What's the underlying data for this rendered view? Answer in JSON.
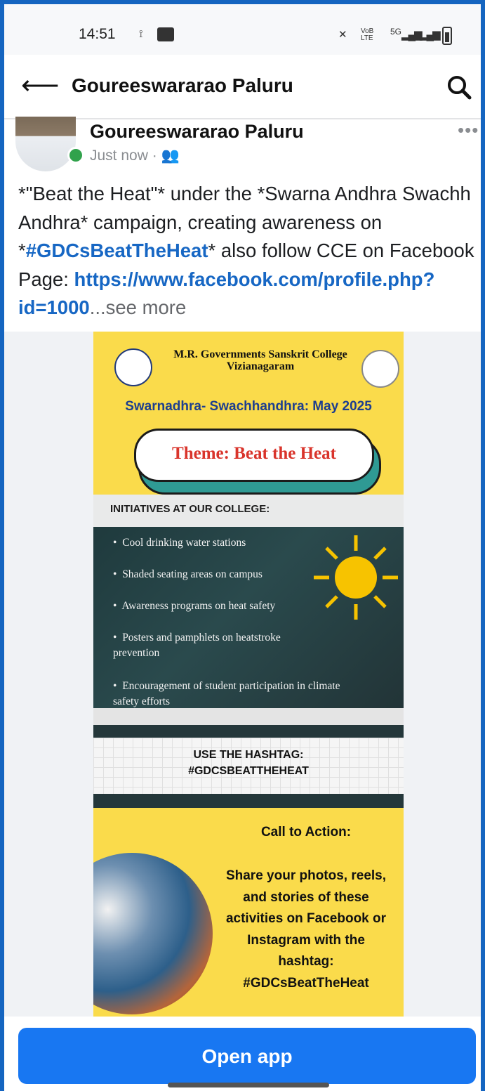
{
  "status_bar": {
    "time": "14:51",
    "net_label": "Vo))\nLTE1",
    "signal_label": "5G"
  },
  "top_bar": {
    "title": "Goureeswararao Paluru"
  },
  "post": {
    "author": "Goureeswararao Paluru",
    "time": "Just now",
    "separator": "·",
    "more_label": "•••",
    "text_a": "*\"Beat the Heat\"* under the *Swarna Andhra Swachh Andhra* campaign,  creating awareness on *",
    "hashtag": "#GDCsBeatTheHeat",
    "text_b": "* also follow CCE on Facebook Page: ",
    "link": "https://www.facebook.com/profile.php?id=1000",
    "see_more": "...see more"
  },
  "poster": {
    "college_line1": "M.R. Governments Sanskrit College",
    "college_line2": "Vizianagaram",
    "campaign": "Swarnadhra- Swachhandhra: May 2025",
    "theme": "Theme: Beat the Heat",
    "initiatives_heading": "INITIATIVES AT OUR COLLEGE:",
    "initiatives": [
      "Cool drinking water stations",
      "Shaded seating areas on campus",
      "Awareness programs on heat safety",
      "Posters and pamphlets on heatstroke prevention",
      "Encouragement of student participation in climate safety efforts"
    ],
    "hashtag_line1": "USE THE HASHTAG:",
    "hashtag_line2": "#GDCSBEATTHEHEAT",
    "cta_heading": "Call to Action:",
    "cta_body": "Share your photos, reels, and stories of these activities on Facebook or Instagram with the hashtag: #GDCsBeatTheHeat"
  },
  "bottom": {
    "open_app": "Open app"
  },
  "colors": {
    "facebook_blue": "#1877f2",
    "link_blue": "#1767c4",
    "poster_yellow": "#fadb4b",
    "online_green": "#31a24c"
  }
}
